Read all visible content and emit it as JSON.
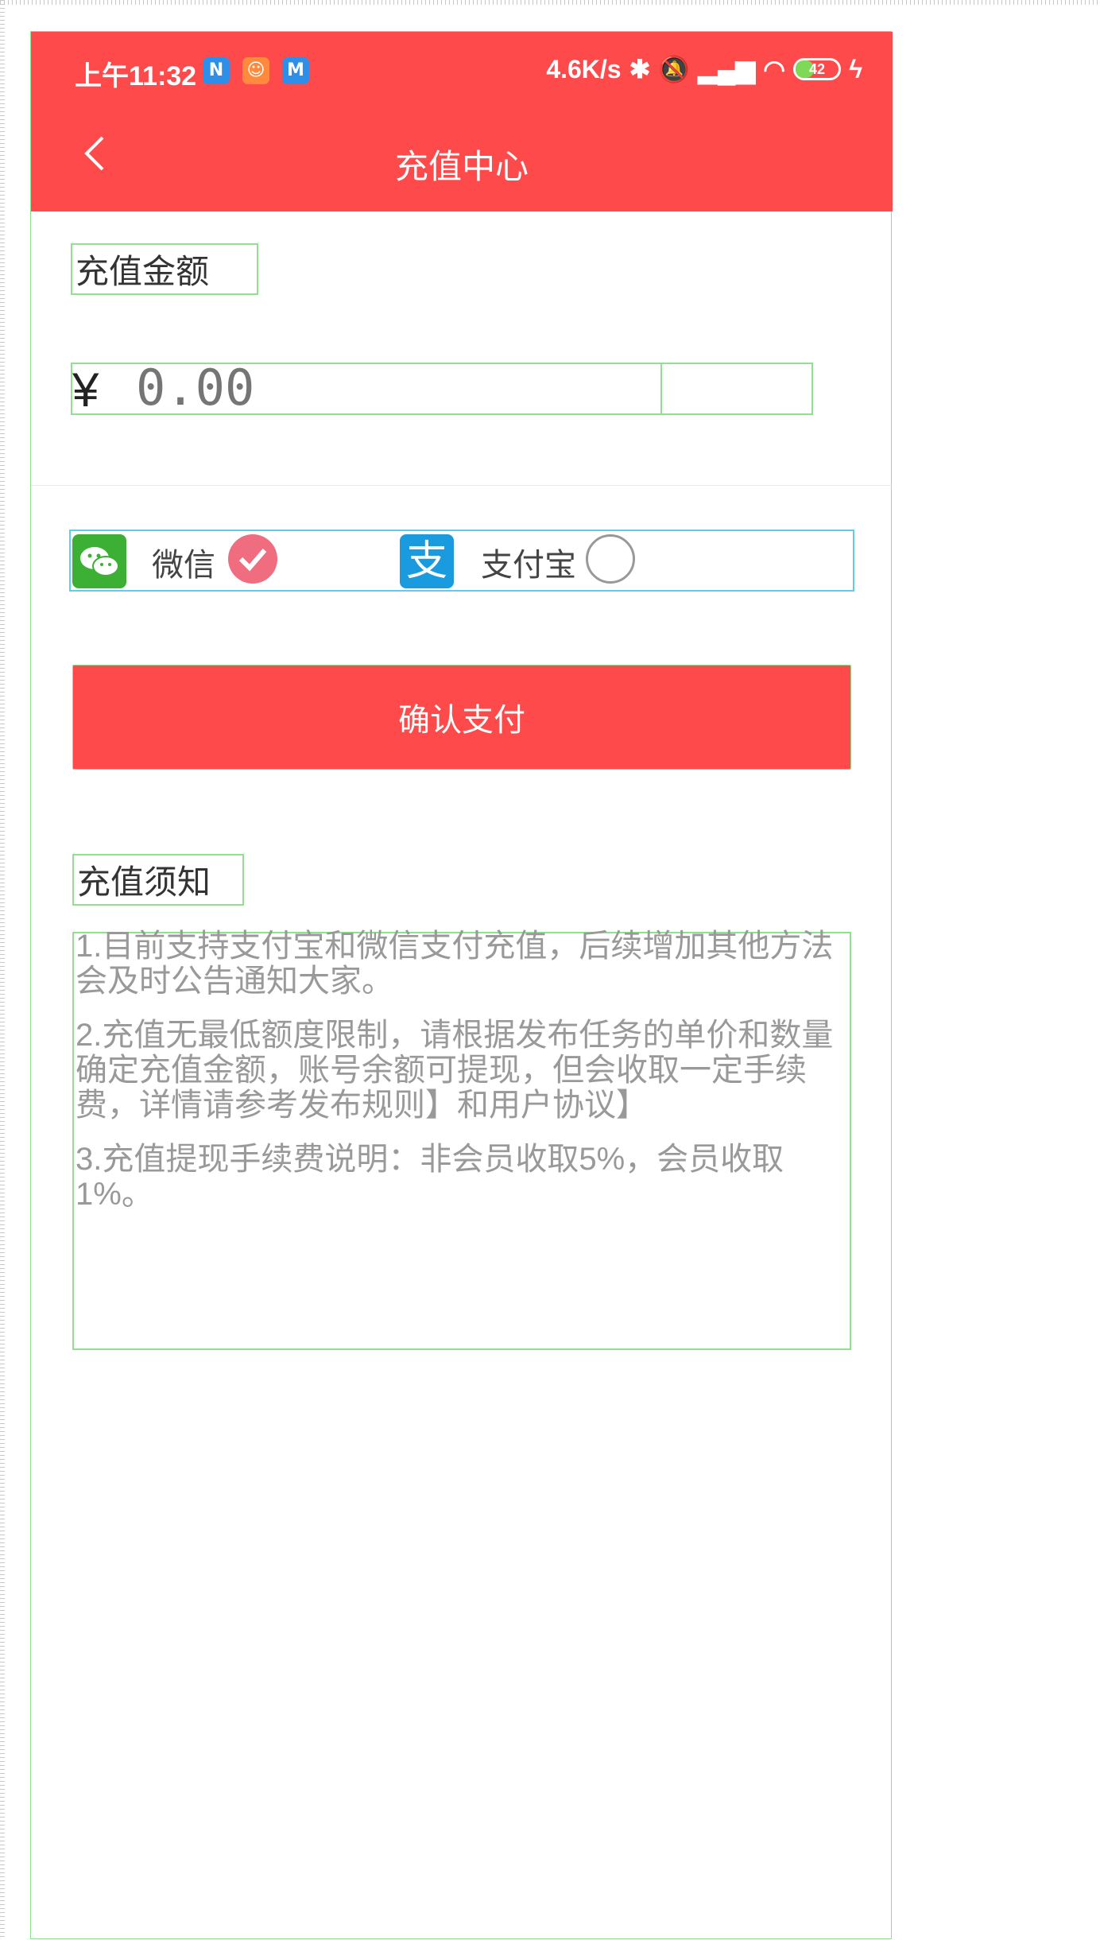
{
  "status_bar": {
    "time": "上午11:32",
    "network_speed": "4.6K/s",
    "battery": "42"
  },
  "header": {
    "title": "充值中心"
  },
  "recharge": {
    "amount_label": "充值金额",
    "currency_symbol": "¥",
    "amount_placeholder": "0.00"
  },
  "payment": {
    "options": [
      {
        "label": "微信",
        "selected": true
      },
      {
        "label": "支付宝",
        "selected": false
      }
    ],
    "accent_color": "#fe4a4a",
    "radio_selected_color": "#f06c7f"
  },
  "submit": {
    "label": "确认支付"
  },
  "notice": {
    "title": "充值须知",
    "items": [
      "1.目前支持支付宝和微信支付充值，后续增加其他方法会及时公告通知大家。",
      "2.充值无最低额度限制，请根据发布任务的单价和数量确定充值金额，账号余额可提现，但会收取一定手续费，详情请参考发布规则】和用户协议】",
      "3.充值提现手续费说明：非会员收取5%，会员收取1%。"
    ]
  },
  "colors": {
    "header_bg": "#fe4a4a",
    "wechat_green": "#3cb034",
    "alipay_blue": "#1a9be0"
  }
}
